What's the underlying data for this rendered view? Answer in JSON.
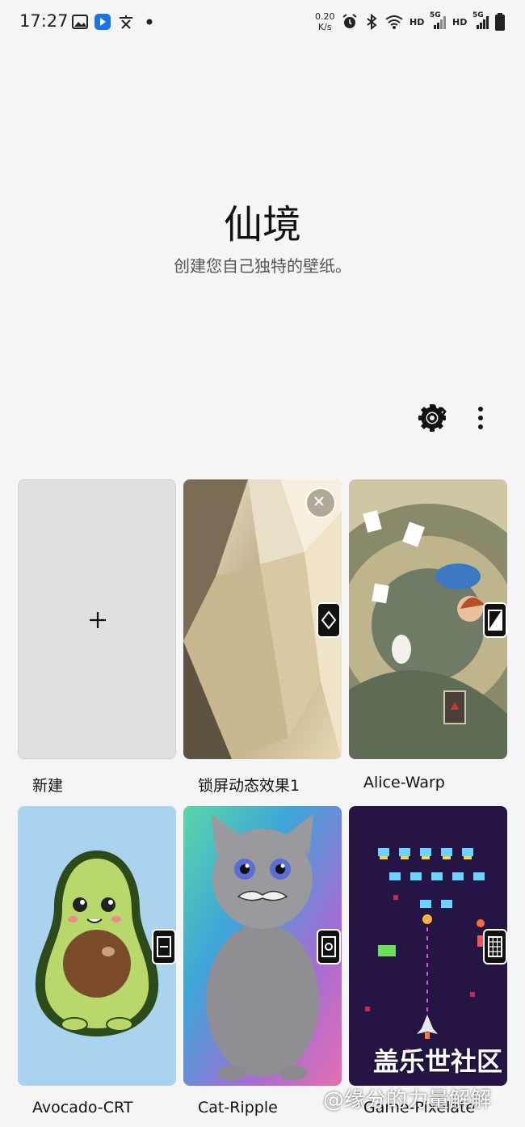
{
  "status_bar": {
    "time": "17:27",
    "net_speed_value": "0.20",
    "net_speed_unit": "K/s",
    "hd1": "HD",
    "sig1": "5G",
    "hd2": "HD",
    "sig2": "5G",
    "icons": [
      "gallery-icon",
      "app-icon",
      "translate-icon",
      "dot-icon",
      "alarm-icon",
      "bluetooth-icon",
      "wifi-icon",
      "battery-icon"
    ]
  },
  "header": {
    "title": "仙境",
    "subtitle": "创建您自己独特的壁纸。"
  },
  "toolbar": {
    "icons": [
      "gear-icon",
      "more-vert-icon"
    ]
  },
  "wallpapers": [
    {
      "label": "新建",
      "icon": "plus-icon"
    },
    {
      "label": "锁屏动态效果1"
    },
    {
      "label": "Alice-Warp"
    },
    {
      "label": "Avocado-CRT"
    },
    {
      "label": "Cat-Ripple"
    },
    {
      "label": "Game-Pixelate"
    }
  ],
  "watermark": {
    "line1": "盖乐世社区",
    "line2": "@缘分的力量解解"
  },
  "colors": {
    "background": "#f5f5f7",
    "new_card": "#e0e0e0",
    "avocado_bg": "#a9d3ee",
    "game_bg": "#241544"
  }
}
